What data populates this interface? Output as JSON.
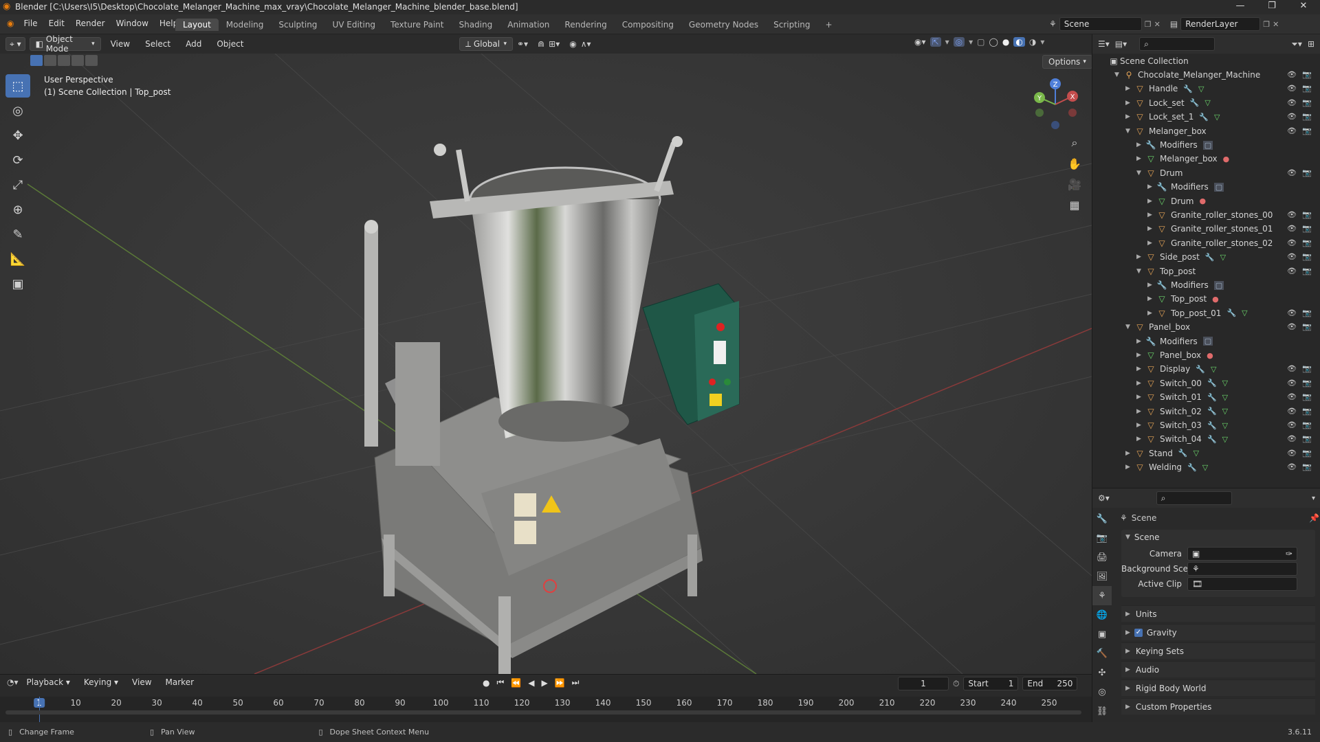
{
  "window": {
    "title": "Blender [C:\\Users\\I5\\Desktop\\Chocolate_Melanger_Machine_max_vray\\Chocolate_Melanger_Machine_blender_base.blend]",
    "controls": [
      "—",
      "❐",
      "✕"
    ]
  },
  "menu": [
    "File",
    "Edit",
    "Render",
    "Window",
    "Help"
  ],
  "workspaces": [
    "Layout",
    "Modeling",
    "Sculpting",
    "UV Editing",
    "Texture Paint",
    "Shading",
    "Animation",
    "Rendering",
    "Compositing",
    "Geometry Nodes",
    "Scripting"
  ],
  "active_workspace": "Layout",
  "add_workspace": "+",
  "scene_selector": "Scene",
  "renderlayer_selector": "RenderLayer",
  "viewport_header": {
    "mode": "Object Mode",
    "menus": [
      "View",
      "Select",
      "Add",
      "Object"
    ],
    "transform_orientation": "Global",
    "options_label": "Options"
  },
  "viewport": {
    "perspective": "User Perspective",
    "collection_info": "(1) Scene Collection | Top_post",
    "gizmo_z": "Z",
    "gizmo_x": "X",
    "gizmo_y": "Y"
  },
  "tools": [
    "select-box-icon",
    "cursor-icon",
    "move-icon",
    "rotate-icon",
    "scale-icon",
    "transform-icon",
    "annotate-icon",
    "measure-icon",
    "add-cube-icon"
  ],
  "outliner": {
    "root": "Scene Collection",
    "items": [
      {
        "label": "Chocolate_Melanger_Machine",
        "depth": 1,
        "open": true,
        "type": "collection",
        "vis": true
      },
      {
        "label": "Handle",
        "depth": 2,
        "open": false,
        "type": "object",
        "vis": true,
        "extras": [
          "wrench",
          "mesh"
        ]
      },
      {
        "label": "Lock_set",
        "depth": 2,
        "open": false,
        "type": "object",
        "vis": true,
        "extras": [
          "wrench",
          "mesh"
        ]
      },
      {
        "label": "Lock_set_1",
        "depth": 2,
        "open": false,
        "type": "object",
        "vis": true,
        "extras": [
          "wrench",
          "mesh"
        ]
      },
      {
        "label": "Melanger_box",
        "depth": 2,
        "open": true,
        "type": "object",
        "vis": true,
        "extras": []
      },
      {
        "label": "Modifiers",
        "depth": 3,
        "open": false,
        "type": "modifiers",
        "vis": false,
        "extras": [
          "modbox"
        ]
      },
      {
        "label": "Melanger_box",
        "depth": 3,
        "open": false,
        "type": "mesh",
        "vis": false,
        "extras": [
          "material"
        ]
      },
      {
        "label": "Drum",
        "depth": 3,
        "open": true,
        "type": "object",
        "vis": true,
        "extras": []
      },
      {
        "label": "Modifiers",
        "depth": 4,
        "open": false,
        "type": "modifiers",
        "vis": false,
        "extras": [
          "modbox"
        ]
      },
      {
        "label": "Drum",
        "depth": 4,
        "open": false,
        "type": "mesh",
        "vis": false,
        "extras": [
          "material"
        ]
      },
      {
        "label": "Granite_roller_stones_00",
        "depth": 4,
        "open": false,
        "type": "object",
        "vis": true,
        "extras": []
      },
      {
        "label": "Granite_roller_stones_01",
        "depth": 4,
        "open": false,
        "type": "object",
        "vis": true,
        "extras": []
      },
      {
        "label": "Granite_roller_stones_02",
        "depth": 4,
        "open": false,
        "type": "object",
        "vis": true,
        "extras": []
      },
      {
        "label": "Side_post",
        "depth": 3,
        "open": false,
        "type": "object",
        "vis": true,
        "extras": [
          "wrench",
          "mesh"
        ]
      },
      {
        "label": "Top_post",
        "depth": 3,
        "open": true,
        "type": "object",
        "vis": true,
        "extras": []
      },
      {
        "label": "Modifiers",
        "depth": 4,
        "open": false,
        "type": "modifiers",
        "vis": false,
        "extras": [
          "modbox"
        ]
      },
      {
        "label": "Top_post",
        "depth": 4,
        "open": false,
        "type": "mesh",
        "vis": false,
        "extras": [
          "material"
        ]
      },
      {
        "label": "Top_post_01",
        "depth": 4,
        "open": false,
        "type": "object",
        "vis": true,
        "extras": [
          "wrench",
          "mesh"
        ]
      },
      {
        "label": "Panel_box",
        "depth": 2,
        "open": true,
        "type": "object",
        "vis": true,
        "extras": []
      },
      {
        "label": "Modifiers",
        "depth": 3,
        "open": false,
        "type": "modifiers",
        "vis": false,
        "extras": [
          "modbox"
        ]
      },
      {
        "label": "Panel_box",
        "depth": 3,
        "open": false,
        "type": "mesh",
        "vis": false,
        "extras": [
          "material"
        ]
      },
      {
        "label": "Display",
        "depth": 3,
        "open": false,
        "type": "object",
        "vis": true,
        "extras": [
          "wrench",
          "mesh"
        ]
      },
      {
        "label": "Switch_00",
        "depth": 3,
        "open": false,
        "type": "object",
        "vis": true,
        "extras": [
          "wrench",
          "mesh"
        ]
      },
      {
        "label": "Switch_01",
        "depth": 3,
        "open": false,
        "type": "object",
        "vis": true,
        "extras": [
          "wrench",
          "mesh"
        ]
      },
      {
        "label": "Switch_02",
        "depth": 3,
        "open": false,
        "type": "object",
        "vis": true,
        "extras": [
          "wrench",
          "mesh"
        ]
      },
      {
        "label": "Switch_03",
        "depth": 3,
        "open": false,
        "type": "object",
        "vis": true,
        "extras": [
          "wrench",
          "mesh"
        ]
      },
      {
        "label": "Switch_04",
        "depth": 3,
        "open": false,
        "type": "object",
        "vis": true,
        "extras": [
          "wrench",
          "mesh"
        ]
      },
      {
        "label": "Stand",
        "depth": 2,
        "open": false,
        "type": "object",
        "vis": true,
        "extras": [
          "wrench",
          "mesh"
        ]
      },
      {
        "label": "Welding",
        "depth": 2,
        "open": false,
        "type": "object",
        "vis": true,
        "extras": [
          "wrench",
          "mesh"
        ]
      }
    ]
  },
  "properties": {
    "context": "Scene",
    "panel_title": "Scene",
    "camera_label": "Camera",
    "background_scene_label": "Background Scene",
    "active_clip_label": "Active Clip",
    "sections": [
      "Units",
      "Gravity",
      "Keying Sets",
      "Audio",
      "Rigid Body World",
      "Custom Properties"
    ],
    "gravity_checked": true
  },
  "timeline": {
    "menus": [
      "Playback",
      "Keying",
      "View",
      "Marker"
    ],
    "current_frame": "1",
    "start_label": "Start",
    "start": "1",
    "end_label": "End",
    "end": "250",
    "ruler": [
      "1",
      "10",
      "20",
      "30",
      "40",
      "50",
      "60",
      "70",
      "80",
      "90",
      "100",
      "110",
      "120",
      "130",
      "140",
      "150",
      "160",
      "170",
      "180",
      "190",
      "200",
      "210",
      "220",
      "230",
      "240",
      "250"
    ]
  },
  "statusbar": {
    "hint1": "Change Frame",
    "hint2": "Pan View",
    "hint3": "Dope Sheet Context Menu",
    "version": "3.6.11"
  },
  "colors": {
    "accent": "#4772b3",
    "object_orange": "#e8a657",
    "mesh_green": "#6bd66b",
    "wrench_blue": "#7b9be6",
    "material_red": "#e06b6b",
    "x_axis": "#c44d4d",
    "y_axis": "#7ab84a",
    "z_axis": "#4f7fd9"
  }
}
